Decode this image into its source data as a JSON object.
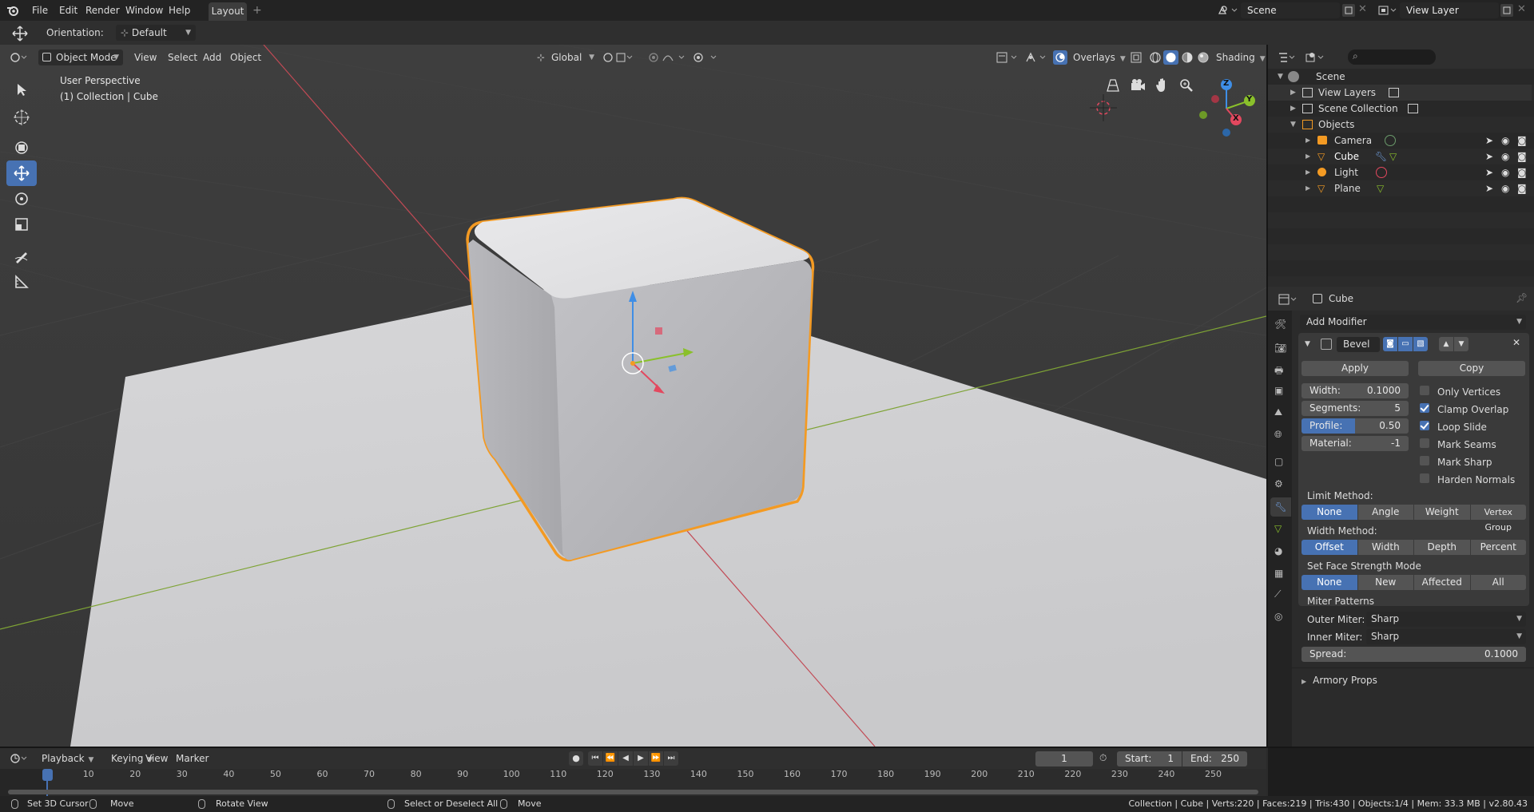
{
  "topbar": {
    "menus": [
      "File",
      "Edit",
      "Render",
      "Window",
      "Help"
    ],
    "workspace_tab": "Layout",
    "scene_name": "Scene",
    "view_layer_name": "View Layer"
  },
  "toolheader": {
    "orientation_label": "Orientation:",
    "orientation_value": "Default"
  },
  "viewport": {
    "mode": "Object Mode",
    "menus": [
      "View",
      "Select",
      "Add",
      "Object"
    ],
    "transform_orientation": "Global",
    "overlays_label": "Overlays",
    "shading_label": "Shading",
    "info_line1": "User Perspective",
    "info_line2": "(1) Collection | Cube",
    "gizmo_x": "X",
    "gizmo_y": "Y",
    "gizmo_z": "Z"
  },
  "outliner": {
    "rows": [
      {
        "label": "Scene"
      },
      {
        "label": "View Layers"
      },
      {
        "label": "Scene Collection"
      },
      {
        "label": "Objects"
      },
      {
        "label": "Camera"
      },
      {
        "label": "Cube"
      },
      {
        "label": "Light"
      },
      {
        "label": "Plane"
      }
    ]
  },
  "properties": {
    "object_name": "Cube",
    "add_modifier": "Add Modifier",
    "modifier_name": "Bevel",
    "apply": "Apply",
    "copy": "Copy",
    "fields": [
      {
        "label": "Width:",
        "value": "0.1000"
      },
      {
        "label": "Segments:",
        "value": "5"
      },
      {
        "label": "Profile:",
        "value": "0.50",
        "fill": 0.5
      },
      {
        "label": "Material:",
        "value": "-1"
      }
    ],
    "checks": [
      {
        "label": "Only Vertices",
        "on": false
      },
      {
        "label": "Clamp Overlap",
        "on": true
      },
      {
        "label": "Loop Slide",
        "on": true
      },
      {
        "label": "Mark Seams",
        "on": false
      },
      {
        "label": "Mark Sharp",
        "on": false
      },
      {
        "label": "Harden Normals",
        "on": false
      }
    ],
    "limit_method_label": "Limit Method:",
    "limit_method": [
      "None",
      "Angle",
      "Weight",
      "Vertex Group"
    ],
    "width_method_label": "Width Method:",
    "width_method": [
      "Offset",
      "Width",
      "Depth",
      "Percent"
    ],
    "face_strength_label": "Set Face Strength Mode",
    "face_strength": [
      "None",
      "New",
      "Affected",
      "All"
    ],
    "miter_label": "Miter Patterns",
    "outer_miter_label": "Outer Miter:",
    "outer_miter_value": "Sharp",
    "inner_miter_label": "Inner Miter:",
    "inner_miter_value": "Sharp",
    "spread_label": "Spread:",
    "spread_value": "0.1000",
    "armory": "Armory Props"
  },
  "timeline": {
    "menus": [
      "Playback",
      "Keying",
      "View",
      "Marker"
    ],
    "current_frame": "1",
    "start_label": "Start:",
    "start_value": "1",
    "end_label": "End:",
    "end_value": "250",
    "ruler": [
      "1",
      "10",
      "20",
      "30",
      "40",
      "50",
      "60",
      "70",
      "80",
      "90",
      "100",
      "110",
      "120",
      "130",
      "140",
      "150",
      "160",
      "170",
      "180",
      "190",
      "200",
      "210",
      "220",
      "230",
      "240",
      "250"
    ]
  },
  "statusbar": {
    "hint1": "Set 3D Cursor",
    "hint2": "Move",
    "hint3": "Rotate View",
    "hint4": "Select or Deselect All",
    "hint5": "Move",
    "stats": "Collection | Cube | Verts:220 | Faces:219 | Tris:430 | Objects:1/4 | Mem: 33.3 MB | v2.80.43"
  },
  "colors": {
    "accent": "#4772b3",
    "selection": "#f39a23",
    "x_axis": "#e3485f",
    "y_axis": "#8ac02b",
    "z_axis": "#3f8ee6"
  }
}
